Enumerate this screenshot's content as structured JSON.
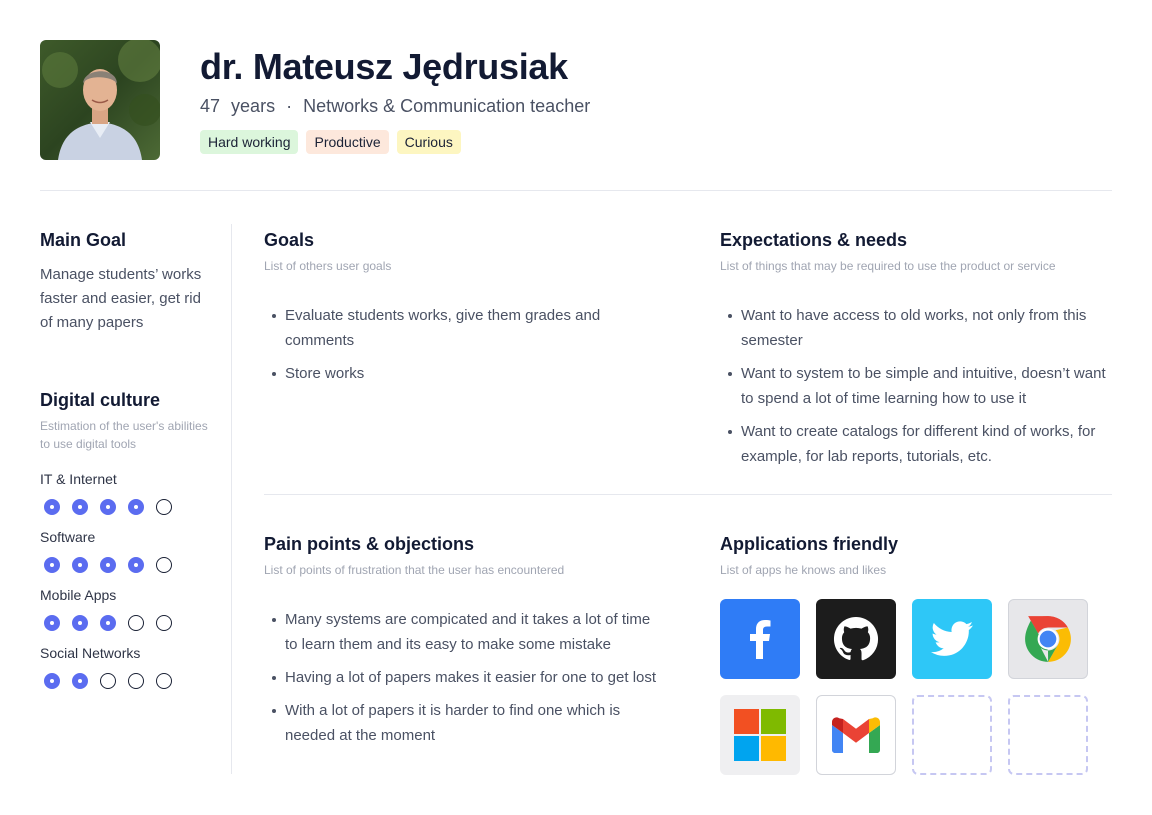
{
  "profile": {
    "name": "dr. Mateusz Jędrusiak",
    "age": "47",
    "age_unit": "years",
    "separator": "·",
    "role": "Networks & Communication teacher",
    "tags": [
      {
        "label": "Hard working",
        "color": "#dcf6dc"
      },
      {
        "label": "Productive",
        "color": "#fde8dc"
      },
      {
        "label": "Curious",
        "color": "#fdf6c1"
      }
    ]
  },
  "main_goal": {
    "title": "Main Goal",
    "text": "Manage students’ works faster and easier, get rid of many papers"
  },
  "digital_culture": {
    "title": "Digital culture",
    "caption": "Estimation of the user's abilities to use digital tools",
    "accent": "#5b6cf0",
    "skills": [
      {
        "label": "IT & Internet",
        "level": 4,
        "max": 5
      },
      {
        "label": "Software",
        "level": 4,
        "max": 5
      },
      {
        "label": "Mobile Apps",
        "level": 3,
        "max": 5
      },
      {
        "label": "Social Networks",
        "level": 2,
        "max": 5
      }
    ]
  },
  "goals": {
    "title": "Goals",
    "caption": "List of others user goals",
    "items": [
      "Evaluate students works, give them grades and comments",
      "Store works"
    ]
  },
  "expectations": {
    "title": "Expectations & needs",
    "caption": "List of things that may be required to use the product or service",
    "items": [
      "Want to have access to old works, not only from this semester",
      "Want to system to be simple and intuitive, doesn’t want to spend a lot of time learning how to use it",
      "Want to create catalogs for different kind of works, for example, for lab reports, tutorials, etc."
    ]
  },
  "pain_points": {
    "title": "Pain points & objections",
    "caption": "List of points of frustration that the user has encountered",
    "items": [
      "Many systems are compicated and it takes a lot of time to learn them and its easy to make some mistake",
      "Having a lot of papers makes it easier for one to get lost",
      "With a lot of papers it is harder to find one which is needed at the moment"
    ]
  },
  "applications": {
    "title": "Applications friendly",
    "caption": "List of apps he knows and likes",
    "apps": [
      {
        "icon": "facebook-icon",
        "color": "#2f7cf6"
      },
      {
        "icon": "github-icon",
        "color": "#1c1c1c"
      },
      {
        "icon": "twitter-icon",
        "color": "#2ec7f7"
      },
      {
        "icon": "chrome-icon",
        "color": "#e7e7ea"
      },
      {
        "icon": "microsoft-icon",
        "color": "#efeff1"
      },
      {
        "icon": "gmail-icon",
        "color": "#ffffff"
      },
      {
        "icon": "empty-slot",
        "color": "#ffffff"
      },
      {
        "icon": "empty-slot",
        "color": "#ffffff"
      }
    ]
  }
}
